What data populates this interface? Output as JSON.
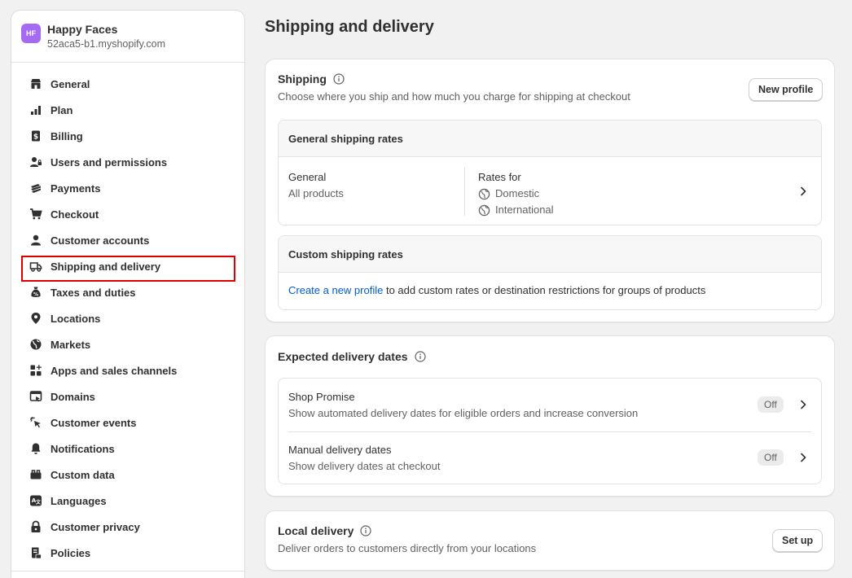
{
  "store": {
    "initials": "HF",
    "name": "Happy Faces",
    "domain": "52aca5-b1.myshopify.com"
  },
  "nav": [
    {
      "label": "General",
      "icon": "store-icon"
    },
    {
      "label": "Plan",
      "icon": "plan-icon"
    },
    {
      "label": "Billing",
      "icon": "billing-icon"
    },
    {
      "label": "Users and permissions",
      "icon": "users-icon"
    },
    {
      "label": "Payments",
      "icon": "payments-icon"
    },
    {
      "label": "Checkout",
      "icon": "cart-icon"
    },
    {
      "label": "Customer accounts",
      "icon": "person-icon"
    },
    {
      "label": "Shipping and delivery",
      "icon": "truck-icon",
      "active": true
    },
    {
      "label": "Taxes and duties",
      "icon": "tax-icon"
    },
    {
      "label": "Locations",
      "icon": "location-pin-icon"
    },
    {
      "label": "Markets",
      "icon": "globe-icon"
    },
    {
      "label": "Apps and sales channels",
      "icon": "apps-icon"
    },
    {
      "label": "Domains",
      "icon": "domains-icon"
    },
    {
      "label": "Customer events",
      "icon": "cursor-click-icon"
    },
    {
      "label": "Notifications",
      "icon": "bell-icon"
    },
    {
      "label": "Custom data",
      "icon": "custom-data-icon"
    },
    {
      "label": "Languages",
      "icon": "languages-icon"
    },
    {
      "label": "Customer privacy",
      "icon": "lock-icon"
    },
    {
      "label": "Policies",
      "icon": "policies-icon"
    }
  ],
  "page": {
    "title": "Shipping and delivery"
  },
  "shipping": {
    "title": "Shipping",
    "subtitle": "Choose where you ship and how much you charge for shipping at checkout",
    "new_profile_label": "New profile",
    "general_rates": {
      "header": "General shipping rates",
      "profile_name": "General",
      "profile_products": "All products",
      "rates_for_label": "Rates for",
      "zones": [
        "Domestic",
        "International"
      ]
    },
    "custom_rates": {
      "header": "Custom shipping rates",
      "link_text": "Create a new profile",
      "rest_text": " to add custom rates or destination restrictions for groups of products"
    }
  },
  "delivery_dates": {
    "title": "Expected delivery dates",
    "items": [
      {
        "title": "Shop Promise",
        "desc": "Show automated delivery dates for eligible orders and increase conversion",
        "status": "Off"
      },
      {
        "title": "Manual delivery dates",
        "desc": "Show delivery dates at checkout",
        "status": "Off"
      }
    ]
  },
  "local_delivery": {
    "title": "Local delivery",
    "subtitle": "Deliver orders to customers directly from your locations",
    "setup_label": "Set up"
  },
  "colors": {
    "accent_link": "#005bd3",
    "avatar_bg": "#a46bf2",
    "highlight_border": "#e00000"
  }
}
